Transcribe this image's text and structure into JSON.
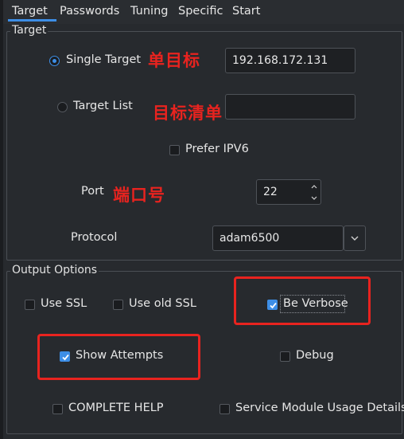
{
  "tabs": [
    {
      "label": "Target",
      "active": true
    },
    {
      "label": "Passwords",
      "active": false
    },
    {
      "label": "Tuning",
      "active": false
    },
    {
      "label": "Specific",
      "active": false
    },
    {
      "label": "Start",
      "active": false
    }
  ],
  "target_group": {
    "title": "Target",
    "single_target_label": "Single Target",
    "single_target_selected": true,
    "single_target_value": "192.168.172.131",
    "target_list_label": "Target List",
    "target_list_selected": false,
    "target_list_value": "",
    "prefer_ipv6_label": "Prefer IPV6",
    "prefer_ipv6_checked": false,
    "port_label": "Port",
    "port_value": "22",
    "protocol_label": "Protocol",
    "protocol_value": "adam6500"
  },
  "annotations": {
    "single_target_note": "单目标",
    "target_list_note": "目标清单",
    "port_note": "端口号"
  },
  "output_group": {
    "title": "Output Options",
    "use_ssl_label": "Use SSL",
    "use_ssl_checked": false,
    "use_old_ssl_label": "Use old SSL",
    "use_old_ssl_checked": false,
    "be_verbose_label": "Be Verbose",
    "be_verbose_checked": true,
    "show_attempts_label": "Show Attempts",
    "show_attempts_checked": true,
    "debug_label": "Debug",
    "debug_checked": false,
    "complete_help_label": "COMPLETE HELP",
    "complete_help_checked": false,
    "service_module_label": "Service Module Usage Details",
    "service_module_checked": false
  },
  "colors": {
    "accent": "#3d8ee6",
    "annotation_red": "#e8231f",
    "background": "#272a2e"
  }
}
